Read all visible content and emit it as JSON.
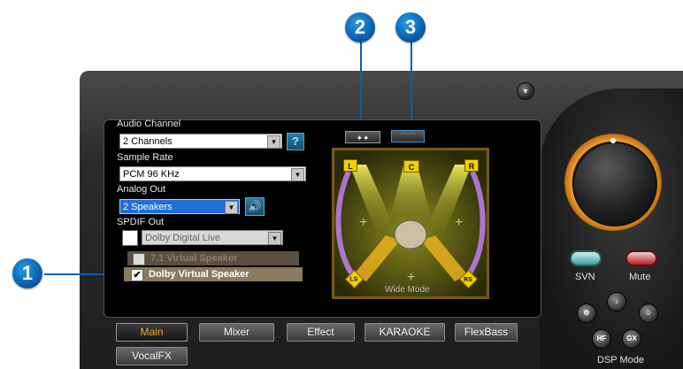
{
  "callouts": [
    "1",
    "2",
    "3"
  ],
  "audio_channel": {
    "label": "Audio Channel",
    "value": "2 Channels",
    "help": "?"
  },
  "sample_rate": {
    "label": "Sample Rate",
    "value": "PCM 96 KHz"
  },
  "analog_out": {
    "label": "Analog Out",
    "value": "2 Speakers"
  },
  "spdif_out": {
    "label": "SPDIF Out",
    "value": "Dolby Digital Live"
  },
  "options": {
    "virtual71": "7.1 Virtual Speaker",
    "dolby_virtual": "Dolby Virtual Speaker",
    "dolby_virtual_checked": true,
    "virtual71_checked": false
  },
  "visualizer": {
    "speakers": {
      "l": "L",
      "c": "C",
      "r": "R",
      "ls": "LS",
      "rs": "RS"
    },
    "mode": "Wide Mode"
  },
  "tabs": [
    "Main",
    "Mixer",
    "Effect",
    "KARAOKE",
    "FlexBass",
    "VocalFX"
  ],
  "right": {
    "svn": "SVN",
    "mute": "Mute",
    "hf": "HF",
    "gx": "GX",
    "dsp_mode": "DSP Mode"
  },
  "colors": {
    "accent_yellow": "#f0d000",
    "knob_orange": "#f0a030",
    "callout_blue": "#0a5fae",
    "selected_blue": "#1f6fd8"
  }
}
